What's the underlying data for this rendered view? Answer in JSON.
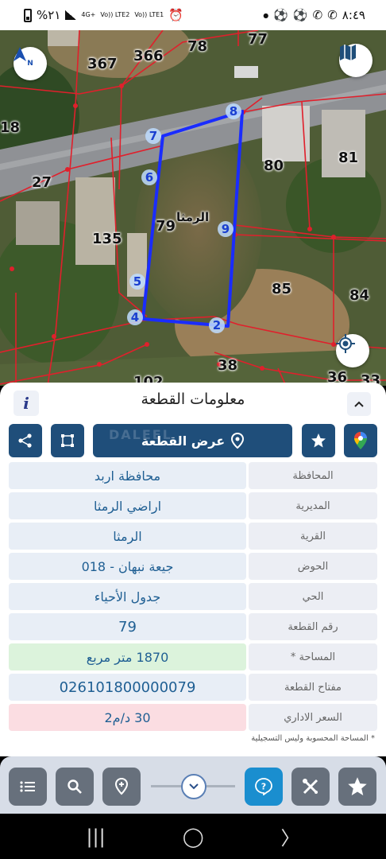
{
  "status_bar": {
    "battery": "%٢١",
    "network_1": "4G+",
    "network_2": "Vo)) LTE2",
    "network_3": "Vo)) LTE1",
    "time": "٨:٤٩"
  },
  "map": {
    "plot_labels": [
      "367",
      "366",
      "78",
      "77",
      "18",
      "27",
      "135",
      "80",
      "81",
      "85",
      "84",
      "38",
      "36",
      "33",
      "102",
      "79"
    ],
    "area_name": "الرمثا",
    "vertices": [
      "8",
      "7",
      "6",
      "9",
      "5",
      "4",
      "2"
    ],
    "colors": {
      "plot_outline": "#1a2cff",
      "parcel_lines": "#e0202c"
    }
  },
  "panel": {
    "title": "معلومات القطعة",
    "info_label": "i",
    "show_plot_label": "عرض القطعة",
    "watermark": "DALEEL",
    "rows": [
      {
        "label": "المحافظة",
        "value": "محافظة اربد"
      },
      {
        "label": "المديرية",
        "value": "اراضي الرمثا"
      },
      {
        "label": "القرية",
        "value": "الرمثا"
      },
      {
        "label": "الحوض",
        "value": "جيعة نبهان - 018"
      },
      {
        "label": "الحي",
        "value": "جدول الأحياء"
      },
      {
        "label": "رقم القطعة",
        "value": "79"
      },
      {
        "label": "المساحة *",
        "value": "1870  متر مربع"
      },
      {
        "label": "مفتاح القطعة",
        "value": "026101800000079"
      },
      {
        "label": "السعر الاداري",
        "value": "30 د/م2"
      }
    ],
    "footnote": "* المساحة المحسوبة وليس التسجيلية"
  },
  "bottom_toolbar": {
    "buttons": [
      "list-icon",
      "search-icon",
      "location-pin-icon",
      "help-icon",
      "tools-icon",
      "star-icon"
    ],
    "accent_color": "#1a8ecf"
  },
  "nav_bar": {
    "recents": "|||",
    "home": "◯",
    "back": "〉"
  }
}
